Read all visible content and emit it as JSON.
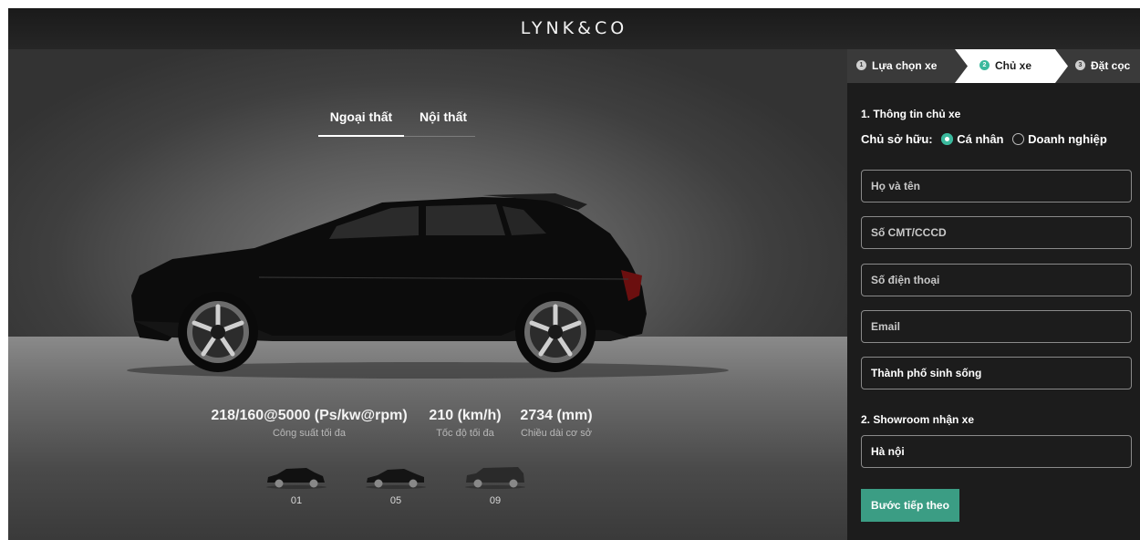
{
  "header": {
    "logo": "LYNK&CO"
  },
  "view_tabs": [
    {
      "label": "Ngoại thất",
      "active": true
    },
    {
      "label": "Nội thất",
      "active": false
    }
  ],
  "specs": [
    {
      "value": "218/160@5000 (Ps/kw@rpm)",
      "label": "Công suất tối đa"
    },
    {
      "value": "210 (km/h)",
      "label": "Tốc độ tối đa"
    },
    {
      "value": "2734 (mm)",
      "label": "Chiều dài cơ sở"
    }
  ],
  "models": [
    {
      "label": "01"
    },
    {
      "label": "05"
    },
    {
      "label": "09"
    }
  ],
  "steps": [
    {
      "num": "1",
      "label": "Lựa chọn xe"
    },
    {
      "num": "2",
      "label": "Chủ xe",
      "active": true
    },
    {
      "num": "3",
      "label": "Đặt cọc"
    }
  ],
  "form": {
    "section1_title": "1. Thông tin chủ xe",
    "owner_label": "Chủ sở hữu:",
    "owner_options": [
      {
        "label": "Cá nhân",
        "selected": true
      },
      {
        "label": "Doanh nghiệp",
        "selected": false
      }
    ],
    "fullname_placeholder": "Họ và tên",
    "id_placeholder": "Số CMT/CCCD",
    "phone_placeholder": "Số điện thoại",
    "email_placeholder": "Email",
    "city_value": "Thành phố sinh sống",
    "section2_title": "2. Showroom nhận xe",
    "showroom_value": "Hà nội",
    "next_button": "Bước tiếp theo"
  },
  "colors": {
    "accent": "#3bb99d",
    "button": "#3b9d84",
    "panel": "#1c1c1c"
  }
}
